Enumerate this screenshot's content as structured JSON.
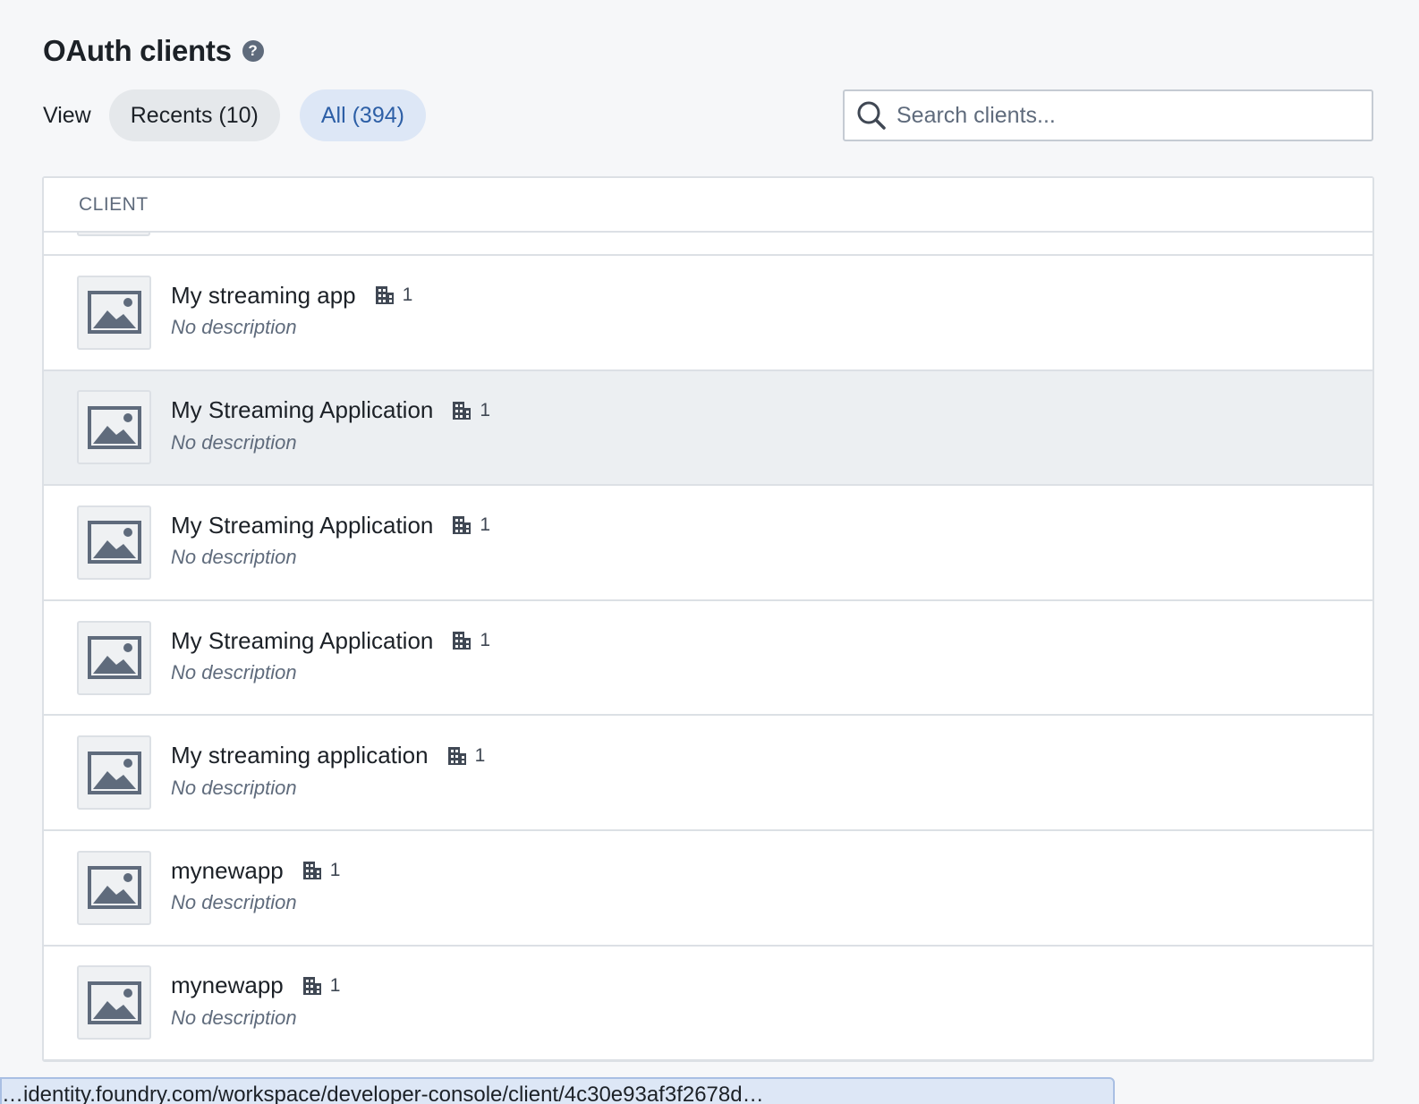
{
  "header": {
    "title": "OAuth clients",
    "help_icon": "help-icon"
  },
  "view": {
    "label": "View",
    "recents_label": "Recents (10)",
    "all_label": "All (394)",
    "selected": "All (394)"
  },
  "search": {
    "placeholder": "Search clients...",
    "value": ""
  },
  "table": {
    "column_header": "CLIENT",
    "rows": [
      {
        "name": "My streaming app",
        "org_count": "1",
        "description": "No description"
      },
      {
        "name": "My Streaming Application",
        "org_count": "1",
        "description": "No description"
      },
      {
        "name": "My Streaming Application",
        "org_count": "1",
        "description": "No description"
      },
      {
        "name": "My Streaming Application",
        "org_count": "1",
        "description": "No description"
      },
      {
        "name": "My streaming application",
        "org_count": "1",
        "description": "No description"
      },
      {
        "name": "mynewapp",
        "org_count": "1",
        "description": "No description"
      },
      {
        "name": "mynewapp",
        "org_count": "1",
        "description": "No description"
      }
    ]
  },
  "colors": {
    "accent": "#2d5fa6",
    "icon_gray": "#5f6b7c",
    "hover_row": "#eceff2"
  },
  "status_bar": {
    "url_text": "…identity.foundry.com/workspace/developer-console/client/4c30e93af3f2678d…"
  }
}
